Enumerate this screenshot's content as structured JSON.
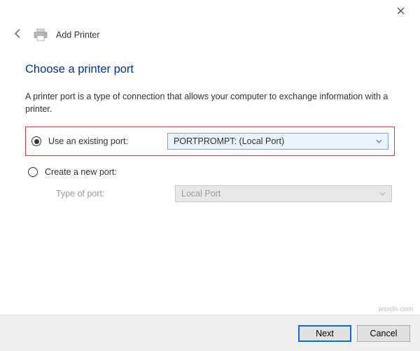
{
  "window": {
    "title": "Add Printer"
  },
  "page": {
    "heading": "Choose a printer port",
    "description": "A printer port is a type of connection that allows your computer to exchange information with a printer."
  },
  "options": {
    "existing": {
      "label": "Use an existing port:",
      "selected": true,
      "dropdown_value": "PORTPROMPT: (Local Port)"
    },
    "create": {
      "label": "Create a new port:",
      "selected": false,
      "type_label": "Type of port:",
      "dropdown_value": "Local Port"
    }
  },
  "footer": {
    "next": "Next",
    "cancel": "Cancel"
  },
  "watermark": "wsxdn.com"
}
